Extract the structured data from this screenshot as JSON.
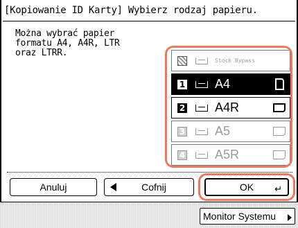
{
  "title": "[Kopiowanie ID Karty] Wybierz rodzaj papieru.",
  "message": [
    "Można wybrać papier",
    "formatu A4, A4R, LTR",
    "oraz LTRR."
  ],
  "paper_items": [
    {
      "num": "",
      "label": "Stock Bypass",
      "orientation": "none",
      "state": "disabled",
      "icon": "stock-bypass-icon"
    },
    {
      "num": "1",
      "label": "A4",
      "orientation": "portrait",
      "state": "selected",
      "icon": "drawer-1-icon"
    },
    {
      "num": "2",
      "label": "A4R",
      "orientation": "landscape",
      "state": "enabled",
      "icon": "drawer-2-icon"
    },
    {
      "num": "3",
      "label": "A5",
      "orientation": "landscape",
      "state": "disabled",
      "icon": "drawer-3-icon"
    },
    {
      "num": "4",
      "label": "A5R",
      "orientation": "landscape",
      "state": "disabled",
      "icon": "drawer-4-icon"
    }
  ],
  "buttons": {
    "cancel": "Anuluj",
    "back": "Cofnij",
    "ok": "OK",
    "ok_enter_glyph": "↵",
    "monitor": "Monitor Systemu"
  },
  "colors": {
    "highlight": "#e87a60",
    "selected_bg": "#000000",
    "disabled_text": "#9a9a9a"
  }
}
